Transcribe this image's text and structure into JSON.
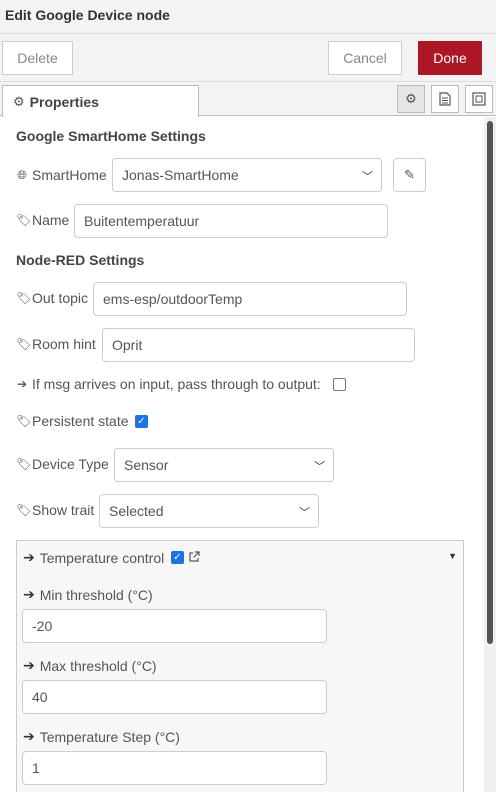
{
  "window": {
    "title": "Edit Google Device node"
  },
  "toolbar": {
    "delete_label": "Delete",
    "cancel_label": "Cancel",
    "done_label": "Done"
  },
  "tabs": {
    "properties_label": "Properties"
  },
  "google_section": {
    "title": "Google SmartHome Settings"
  },
  "smarthome": {
    "label": "SmartHome",
    "value": "Jonas-SmartHome"
  },
  "name": {
    "label": "Name",
    "value": "Buitentemperatuur"
  },
  "nodered_section": {
    "title": "Node-RED Settings"
  },
  "out_topic": {
    "label": "Out topic",
    "value": "ems-esp/outdoorTemp"
  },
  "room_hint": {
    "label": "Room hint",
    "value": "Oprit"
  },
  "passthrough": {
    "label": "If msg arrives on input, pass through to output:",
    "checked": false
  },
  "persistent": {
    "label": "Persistent state",
    "checked": true
  },
  "device_type": {
    "label": "Device Type",
    "value": "Sensor"
  },
  "show_trait": {
    "label": "Show trait",
    "value": "Selected"
  },
  "temperature_control": {
    "label": "Temperature control",
    "checked": true,
    "min": {
      "label": "Min threshold (°C)",
      "value": "-20"
    },
    "max": {
      "label": "Max threshold (°C)",
      "value": "40"
    },
    "step": {
      "label": "Temperature Step (°C)",
      "value": "1"
    }
  },
  "colors": {
    "accent": "#ad1625",
    "checkbox": "#1a73e8"
  }
}
